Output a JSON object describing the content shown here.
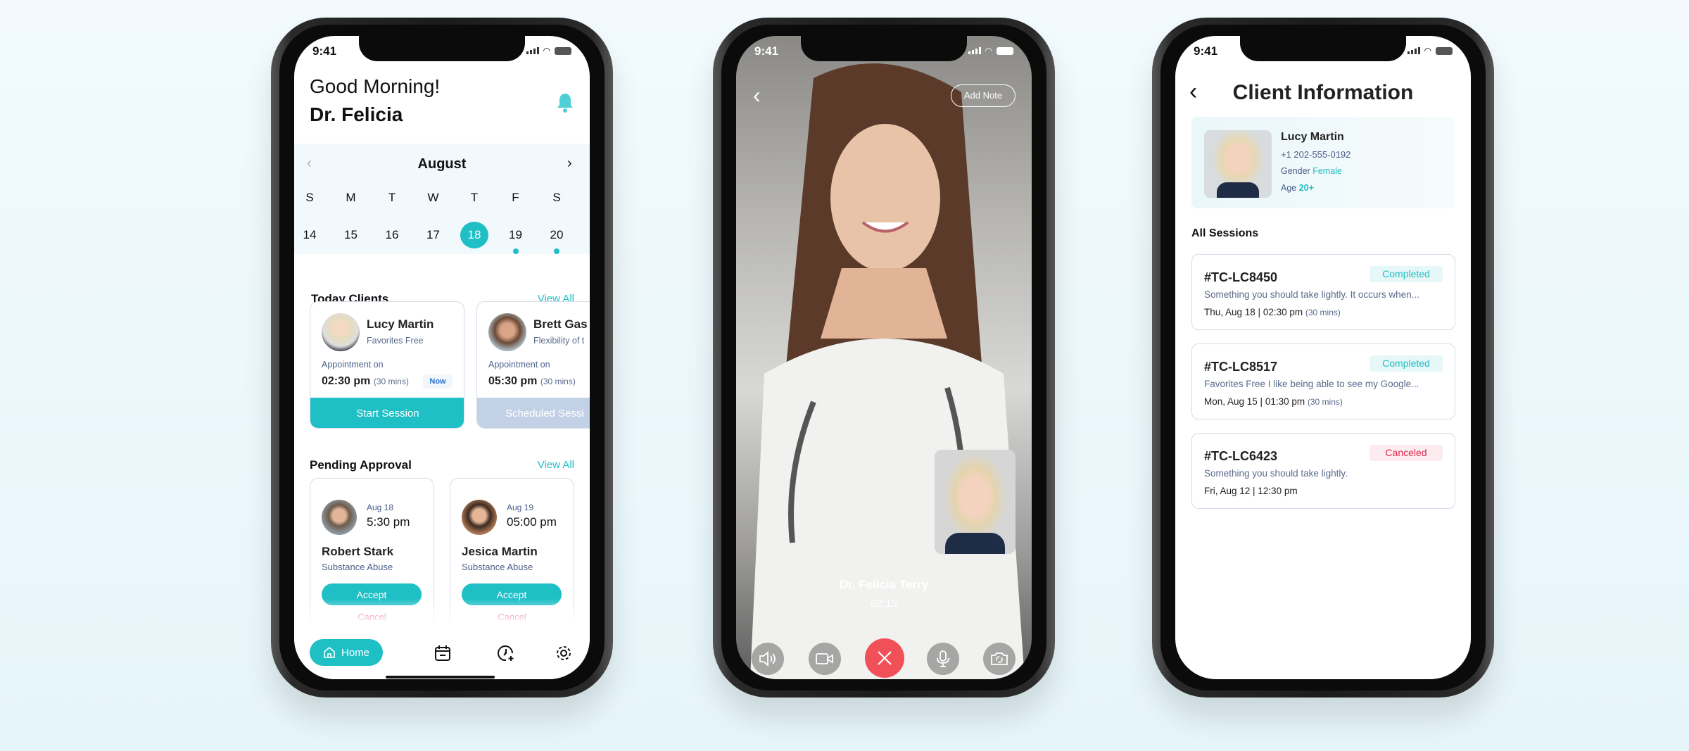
{
  "colors": {
    "accent": "#1fbfc6",
    "danger": "#f25058",
    "cancel_text": "#e0284f",
    "scheduled": "#c3d1e6"
  },
  "status_bar": {
    "time": "9:41"
  },
  "home": {
    "greeting": "Good Morning!",
    "name": "Dr. Felicia",
    "bell_icon": "bell-icon",
    "calendar": {
      "month": "August",
      "weekdays": [
        "S",
        "M",
        "T",
        "W",
        "T",
        "F",
        "S"
      ],
      "dates": [
        "14",
        "15",
        "16",
        "17",
        "18",
        "19",
        "20"
      ],
      "selected": "18",
      "marked": [
        "19",
        "20"
      ]
    },
    "today_clients": {
      "title": "Today Clients",
      "view_all": "View All",
      "items": [
        {
          "name": "Lucy Martin",
          "subtitle": "Favorites Free",
          "appt_label": "Appointment on",
          "time": "02:30 pm",
          "duration": "(30 mins)",
          "badge": "Now",
          "action": "Start Session"
        },
        {
          "name": "Brett Gas",
          "subtitle": "Flexibility of t",
          "appt_label": "Appointment on",
          "time": "05:30 pm",
          "duration": "(30 mins)",
          "action": "Scheduled Sessi"
        }
      ]
    },
    "pending": {
      "title": "Pending Approval",
      "view_all": "View All",
      "items": [
        {
          "date": "Aug 18",
          "time": "5:30 pm",
          "name": "Robert Stark",
          "subtitle": "Substance Abuse",
          "accept": "Accept",
          "cancel": "Cancel"
        },
        {
          "date": "Aug 19",
          "time": "05:00 pm",
          "name": "Jesica Martin",
          "subtitle": "Substance Abuse",
          "accept": "Accept",
          "cancel": "Cancel"
        }
      ]
    },
    "nav": {
      "home": "Home"
    }
  },
  "call": {
    "add_note": "Add Note",
    "caller": "Dr. Felicia Terry",
    "duration": "02:15"
  },
  "client": {
    "title": "Client Information",
    "name": "Lucy Martin",
    "phone": "+1 202-555-0192",
    "gender_label": "Gender",
    "gender": "Female",
    "age_label": "Age",
    "age": "20+",
    "sessions_title": "All Sessions",
    "sessions": [
      {
        "id": "#TC-LC8450",
        "status": "Completed",
        "desc": "Something you should take lightly. It occurs when...",
        "when": "Thu, Aug 18 | 02:30 pm",
        "duration": "(30 mins)"
      },
      {
        "id": "#TC-LC8517",
        "status": "Completed",
        "desc": "Favorites Free I like being able to see my Google...",
        "when": "Mon, Aug 15 | 01:30 pm",
        "duration": "(30 mins)"
      },
      {
        "id": "#TC-LC6423",
        "status": "Canceled",
        "desc": "Something you should take lightly.",
        "when": "Fri, Aug 12 | 12:30 pm",
        "duration": ""
      }
    ]
  }
}
